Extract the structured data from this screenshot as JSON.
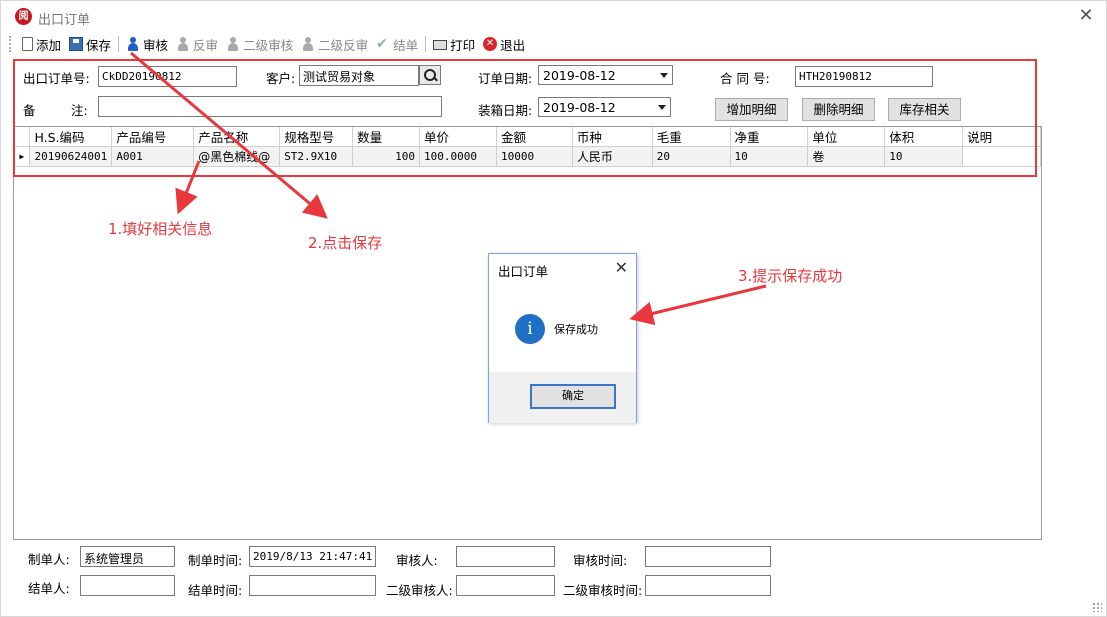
{
  "window": {
    "title": "出口订单",
    "logo_glyph": "阅"
  },
  "toolbar": {
    "add": "添加",
    "save": "保存",
    "audit": "审核",
    "unaudit": "反审",
    "audit2": "二级审核",
    "unaudit2": "二级反审",
    "close_order": "结单",
    "print": "打印",
    "exit": "退出"
  },
  "form": {
    "order_no_label": "出口订单号:",
    "order_no_value": "CkDD20190812",
    "customer_label": "客户:",
    "customer_value": "测试贸易对象",
    "order_date_label": "订单日期:",
    "order_date_value": "2019-08-12",
    "contract_label": "合  同  号:",
    "contract_value": "HTH20190812",
    "remark_label_1": "备",
    "remark_label_2": "注:",
    "remark_value": "",
    "pack_date_label": "装箱日期:",
    "pack_date_value": "2019-08-12",
    "add_detail": "增加明细",
    "delete_detail": "删除明细",
    "stock": "库存相关"
  },
  "grid": {
    "columns": [
      "H.S.编码",
      "产品编号",
      "产品名称",
      "规格型号",
      "数量",
      "单价",
      "金额",
      "币种",
      "毛重",
      "净重",
      "单位",
      "体积",
      "说明"
    ],
    "rows": [
      [
        "20190624001",
        "A001",
        "@黑色棉线@",
        "ST2.9X10",
        "100",
        "100.0000",
        "10000",
        "人民币",
        "20",
        "10",
        "卷",
        "10",
        ""
      ]
    ]
  },
  "bottom": {
    "maker_label": "制单人:",
    "maker_value": "系统管理员",
    "make_time_label": "制单时间:",
    "make_time_value": "2019/8/13 21:47:41",
    "auditor_label": "审核人:",
    "auditor_value": "",
    "audit_time_label": "审核时间:",
    "audit_time_value": "",
    "closer_label": "结单人:",
    "closer_value": "",
    "close_time_label": "结单时间:",
    "close_time_value": "",
    "auditor2_label": "二级审核人:",
    "auditor2_value": "",
    "audit2_time_label": "二级审核时间:",
    "audit2_time_value": ""
  },
  "dialog": {
    "title": "出口订单",
    "message": "保存成功",
    "ok": "确定",
    "icon": "info-icon"
  },
  "annotations": {
    "step1": "1.填好相关信息",
    "step2": "2.点击保存",
    "step3": "3.提示保存成功",
    "color": "#e8383d"
  }
}
